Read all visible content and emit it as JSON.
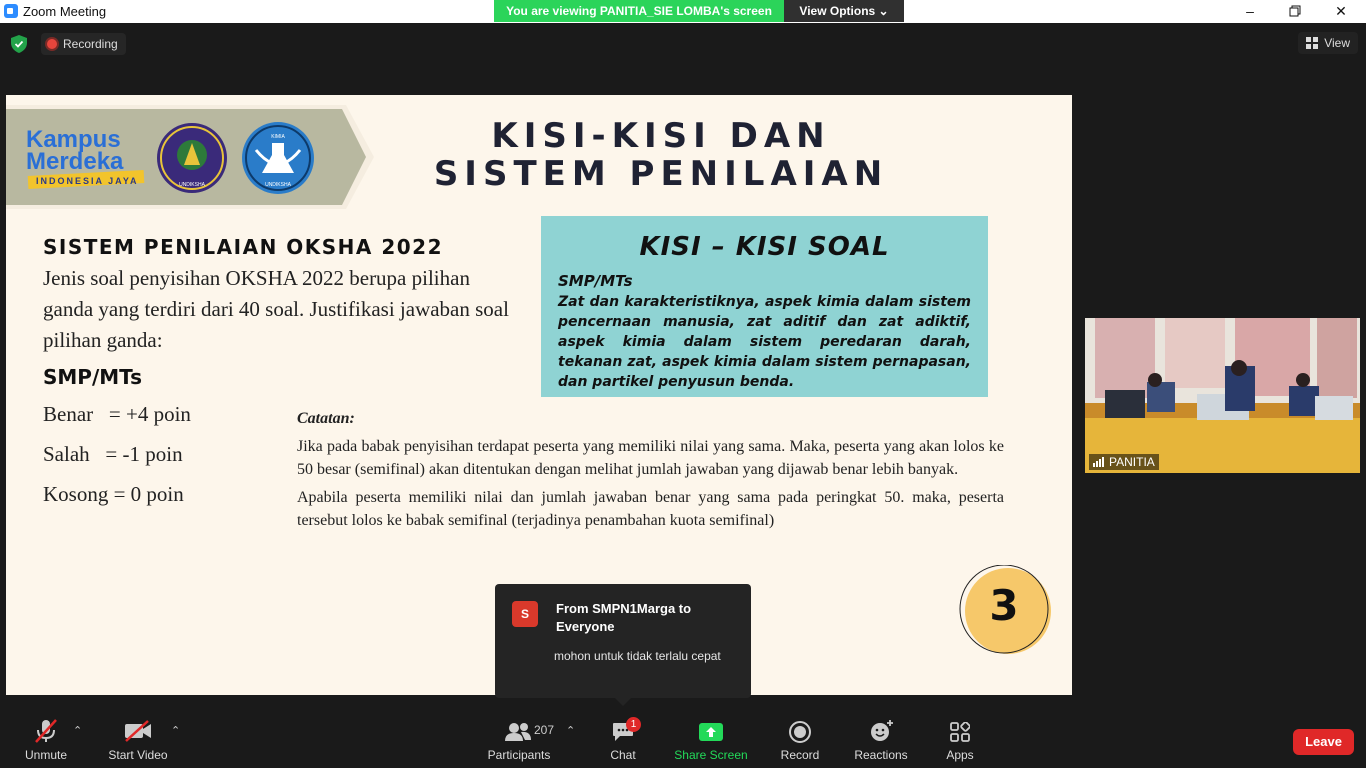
{
  "window": {
    "title": "Zoom Meeting",
    "minimize": "–",
    "maximize": "❐",
    "close": "✕"
  },
  "banner": {
    "viewing_text": "You are viewing PANITIA_SIE LOMBA's screen",
    "view_options_label": "View Options ⌄"
  },
  "topbar": {
    "recording_label": "Recording",
    "view_label": "View"
  },
  "slide": {
    "title_line1": "KISI-KISI DAN",
    "title_line2": "SISTEM PENILAIAN",
    "logo": {
      "kampus": "Kampus",
      "merdeka": "Merdeka",
      "tagline": "INDONESIA JAYA",
      "seal1_text": "UNDIKSHA",
      "seal2_text": "UNDIKSHA",
      "seal2_top": "KIMIA"
    },
    "section_heading": "SISTEM PENILAIAN OKSHA 2022",
    "description": "Jenis soal penyisihan OKSHA 2022 berupa pilihan ganda yang terdiri dari 40 soal. Justifikasi jawaban soal pilihan ganda:",
    "smp_label": "SMP/MTs",
    "scores": [
      "Benar   = +4 poin",
      "Salah   = -1 poin",
      "Kosong = 0 poin"
    ],
    "kisi": {
      "title": "KISI – KISI SOAL",
      "subtitle": "SMP/MTs",
      "body": "Zat dan karakteristiknya, aspek kimia dalam sistem pencernaan manusia, zat aditif dan zat adiktif, aspek kimia dalam sistem peredaran darah, tekanan zat, aspek kimia dalam sistem pernapasan, dan partikel penyusun benda."
    },
    "catatan": {
      "heading": "Catatan:",
      "p1": "Jika pada babak penyisihan terdapat peserta yang memiliki nilai yang sama. Maka, peserta yang akan lolos ke 50 besar (semifinal) akan ditentukan dengan melihat jumlah jawaban yang dijawab benar lebih banyak.",
      "p2": "Apabila peserta memiliki nilai dan jumlah jawaban benar yang sama pada peringkat 50. maka, peserta tersebut lolos ke babak semifinal (terjadinya penambahan kuota semifinal)"
    },
    "page_number": "3"
  },
  "video_tile": {
    "name": "PANITIA"
  },
  "chat_popup": {
    "avatar_letter": "S",
    "from": "From SMPN1Marga to Everyone",
    "message": "mohon untuk tidak terlalu cepat"
  },
  "toolbar": {
    "unmute": "Unmute",
    "start_video": "Start Video",
    "participants": "Participants",
    "participants_count": "207",
    "chat": "Chat",
    "chat_badge": "1",
    "share_screen": "Share Screen",
    "record": "Record",
    "reactions": "Reactions",
    "apps": "Apps",
    "leave": "Leave"
  },
  "colors": {
    "share_green": "#23d959",
    "leave_red": "#e02828",
    "slide_bg": "#fdf6eb",
    "kisi_bg": "#8fd3d3",
    "banner_green": "#2bd45a"
  }
}
